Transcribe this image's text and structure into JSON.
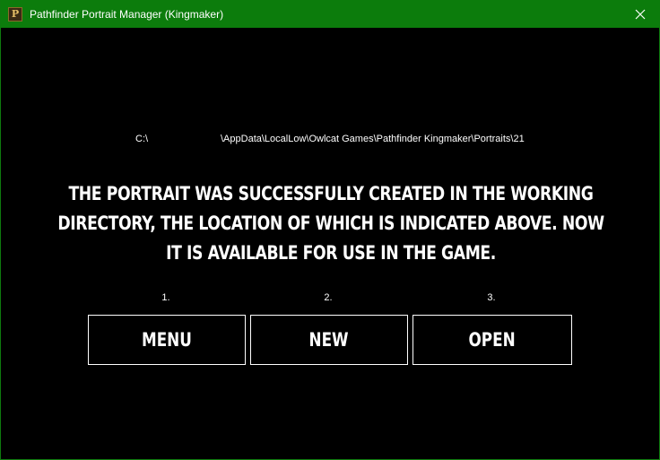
{
  "window": {
    "title": "Pathfinder Portrait Manager (Kingmaker)",
    "app_icon": "pathfinder-icon",
    "close_icon": "close-icon"
  },
  "main": {
    "path_drive": "C:\\",
    "path_rest": "\\AppData\\LocalLow\\Owlcat Games\\Pathfinder Kingmaker\\Portraits\\21",
    "message": "THE PORTRAIT WAS SUCCESSFULLY CREATED IN THE WORKING DIRECTORY, THE LOCATION OF WHICH IS INDICATED ABOVE. NOW IT IS AVAILABLE FOR USE IN THE GAME."
  },
  "actions": [
    {
      "number": "1.",
      "label": "MENU"
    },
    {
      "number": "2.",
      "label": "NEW"
    },
    {
      "number": "3.",
      "label": "OPEN"
    }
  ],
  "colors": {
    "titlebar": "#0c7c0c",
    "background": "#000000",
    "text": "#ffffff"
  }
}
